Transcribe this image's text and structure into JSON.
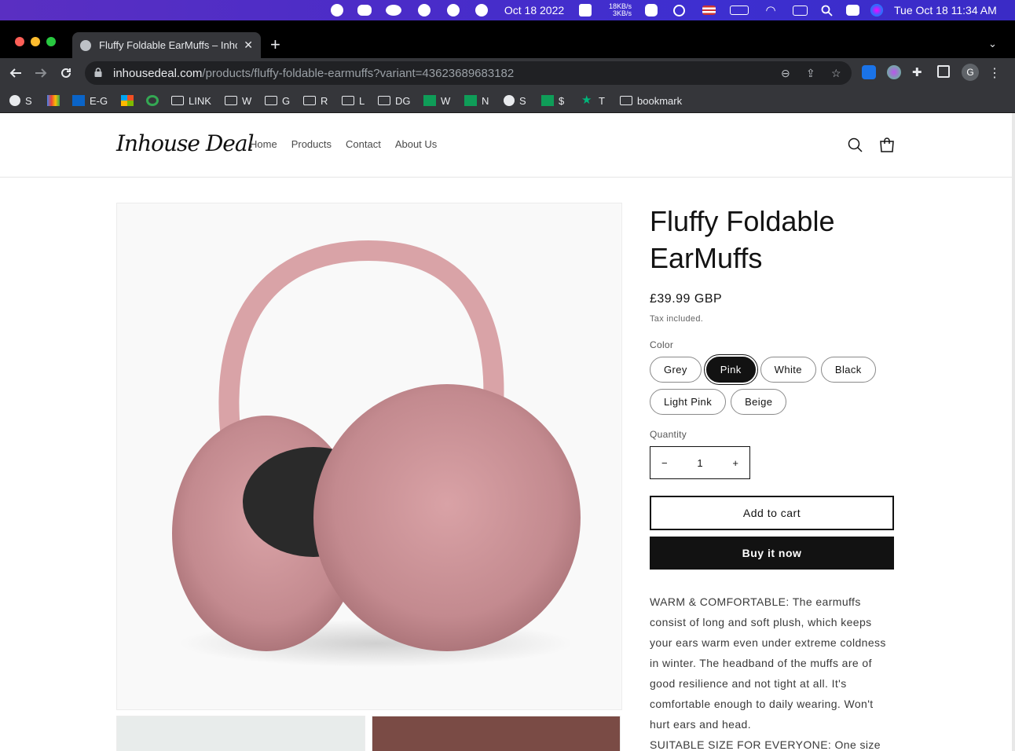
{
  "menubar": {
    "date": "Oct 18 2022",
    "net_up": "18KB/s",
    "net_down": "3KB/s",
    "clock": "Tue Oct 18  11:34 AM"
  },
  "browser": {
    "tab_title": "Fluffy Foldable EarMuffs – Inhouse Deal",
    "url_host": "inhousedeal.com",
    "url_path": "/products/fluffy-foldable-earmuffs?variant=43623689683182",
    "profile_initial": "G",
    "bookmarks": [
      {
        "label": "S",
        "icon": "globe-icon"
      },
      {
        "label": "",
        "icon": "gmail-icon"
      },
      {
        "label": "E-G",
        "icon": "outlook-icon"
      },
      {
        "label": "",
        "icon": "microsoft-icon"
      },
      {
        "label": "",
        "icon": "g-icon"
      },
      {
        "label": "LINK",
        "icon": "folder-icon"
      },
      {
        "label": "W",
        "icon": "folder-icon"
      },
      {
        "label": "G",
        "icon": "folder-icon"
      },
      {
        "label": "R",
        "icon": "folder-icon"
      },
      {
        "label": "L",
        "icon": "folder-icon"
      },
      {
        "label": "DG",
        "icon": "folder-icon"
      },
      {
        "label": "W",
        "icon": "sheets-icon"
      },
      {
        "label": "N",
        "icon": "sheets-icon"
      },
      {
        "label": "S",
        "icon": "globe-icon"
      },
      {
        "label": "$",
        "icon": "sheets-icon"
      },
      {
        "label": "T",
        "icon": "star-icon"
      },
      {
        "label": "bookmark",
        "icon": "folder-icon"
      }
    ]
  },
  "site": {
    "logo": "Inhouse Deal",
    "nav": [
      "Home",
      "Products",
      "Contact",
      "About Us"
    ]
  },
  "product": {
    "title": "Fluffy Foldable EarMuffs",
    "price": "£39.99 GBP",
    "tax_note": "Tax included.",
    "color_label": "Color",
    "colors": [
      "Grey",
      "Pink",
      "White",
      "Black",
      "Light Pink",
      "Beige"
    ],
    "selected_color": "Pink",
    "quantity_label": "Quantity",
    "quantity": "1",
    "add_to_cart": "Add to cart",
    "buy_now": "Buy it now",
    "description_1": "WARM & COMFORTABLE: The earmuffs consist of long and soft plush, which keeps your ears warm even under extreme coldness in winter. The headband of the muffs are of good resilience and not tight at all. It's comfortable enough to daily wearing. Won't hurt ears and head.",
    "description_2": "SUITABLE SIZE FOR EVERYONE: One size fits"
  }
}
